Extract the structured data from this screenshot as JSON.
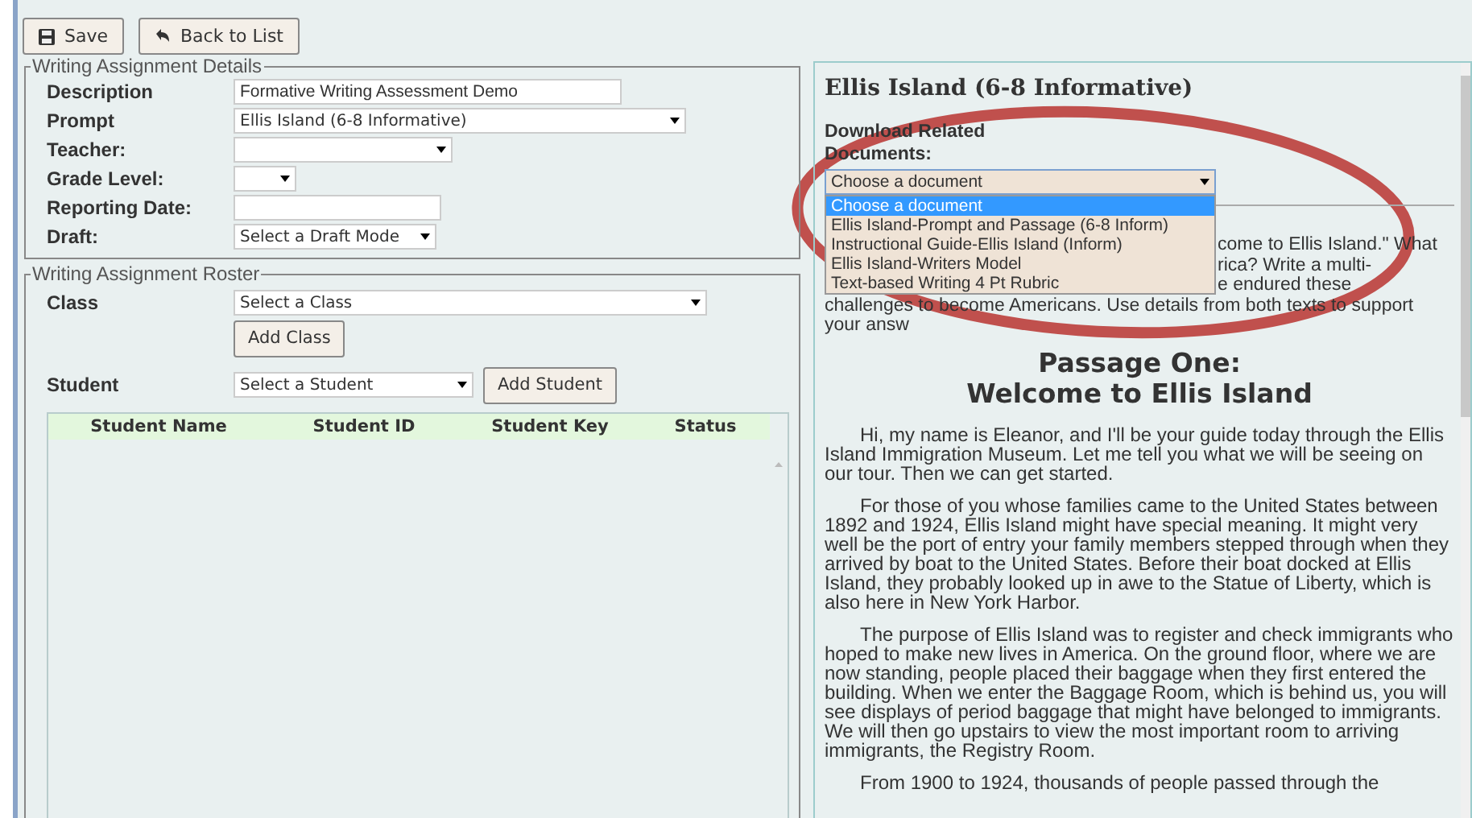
{
  "toolbar": {
    "buttons": [
      {
        "label": "Save"
      },
      {
        "label": "Back to List"
      }
    ]
  },
  "details": {
    "legend": "Writing Assignment Details",
    "fields": [
      {
        "label": "Description",
        "kind": "text",
        "value": "Formative Writing Assessment Demo"
      },
      {
        "label": "Prompt",
        "kind": "select",
        "value": "Ellis Island (6-8 Informative)"
      },
      {
        "label": "Teacher:",
        "kind": "select"
      },
      {
        "label": "Grade Level:",
        "kind": "select"
      },
      {
        "label": "Reporting Date:",
        "kind": "text"
      },
      {
        "label": "Draft:",
        "kind": "select",
        "value": "Select a Draft Mode"
      }
    ]
  },
  "roster": {
    "legend": "Writing Assignment Roster",
    "class_label": "Class",
    "class_select": "Select a Class",
    "add_class": "Add Class",
    "student_label": "Student",
    "student_select": "Select a Student",
    "add_student": "Add Student",
    "columns": [
      "Student Name",
      "Student ID",
      "Student Key",
      "Status"
    ]
  },
  "prompt_panel": {
    "title": "Ellis Island (6-8 Informative)",
    "download_label": "Download Related Documents:",
    "document_select": {
      "value": "Choose a document",
      "expanded": true,
      "options": [
        {
          "label": "Choose a document",
          "selected": true
        },
        {
          "label": "Ellis Island-Prompt and Passage (6-8 Inform)",
          "selected": false
        },
        {
          "label": "Instructional Guide-Ellis Island (Inform)",
          "selected": false
        },
        {
          "label": "Ellis Island-Writers Model",
          "selected": false
        },
        {
          "label": "Text-based Writing 4 Pt Rubric",
          "selected": false
        }
      ]
    },
    "prompt_lines": [
      {
        "text": "come to Ellis Island.\" What",
        "kind": "partial"
      },
      {
        "text": "rica? Write a multi-",
        "kind": "partial"
      },
      {
        "text": "e endured these",
        "kind": "partial"
      },
      {
        "text": "challenges to become Americans. Use details from both texts to support",
        "kind": "full"
      },
      {
        "text": "your answ",
        "kind": "full"
      }
    ],
    "passage_title": [
      "Passage One:",
      "Welcome to Ellis Island"
    ],
    "paragraphs": [
      "Hi, my name is Eleanor, and I'll be your guide today through the Ellis Island Immigration Museum. Let me tell you what we will be seeing on our tour. Then we can get started.",
      "For those of you whose families came to the United States between 1892 and 1924, Ellis Island might have special meaning. It might very well be the port of entry your family members stepped through when they arrived by boat to the United States. Before their boat docked at Ellis Island, they probably looked up in awe to the Statue of Liberty, which is also here in New York Harbor.",
      "The purpose of Ellis Island was to register and check immigrants who hoped to make new lives in America. On the ground floor, where we are now standing, people placed their baggage when they first entered the building. When we enter the Baggage Room, which is behind us, you will see displays of period baggage that might have belonged to immigrants. We will then go upstairs to view the most important room to arriving immigrants, the Registry Room.",
      "From 1900 to 1924, thousands of people passed through the"
    ]
  }
}
